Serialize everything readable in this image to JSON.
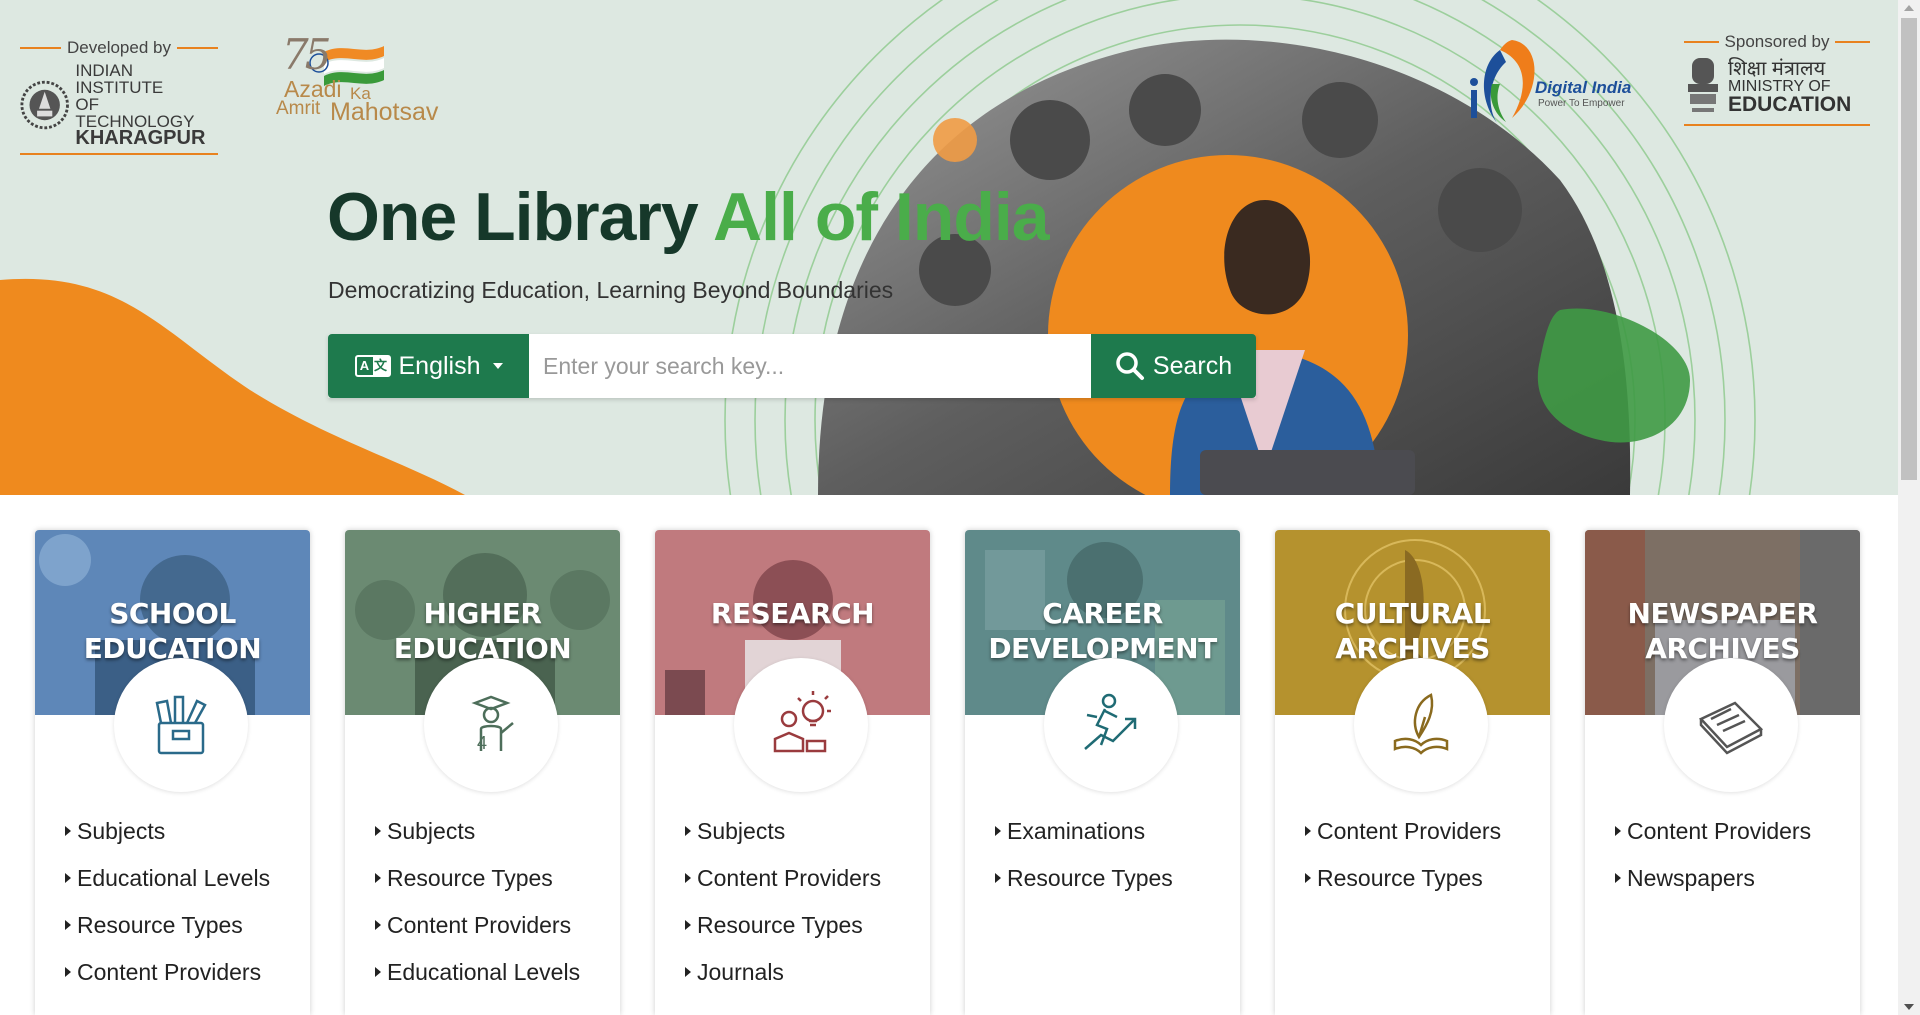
{
  "header": {
    "developed_by": "Developed by",
    "iit_line1": "INDIAN INSTITUTE",
    "iit_line2": "OF TECHNOLOGY",
    "iit_line3": "KHARAGPUR",
    "akam_75": "75",
    "akam_azadi": "Azadi",
    "akam_ka": "Ka",
    "akam_amrit": "Amrit",
    "akam_mahotsav": "Mahotsav",
    "digital_india": "Digital India",
    "digital_tagline": "Power To Empower",
    "sponsored_by": "Sponsored by",
    "moe_hindi": "शिक्षा मंत्रालय",
    "moe_line1": "MINISTRY OF",
    "moe_line2": "EDUCATION"
  },
  "hero": {
    "title_part1": "One Library",
    "title_part2": "All of India",
    "subtitle": "Democratizing Education, Learning Beyond Boundaries",
    "language_label": "English",
    "language_icon_text": [
      "A",
      "文"
    ],
    "search_placeholder": "Enter your search key...",
    "search_button": "Search"
  },
  "cards": [
    {
      "title": "SCHOOL EDUCATION",
      "icon": "school-supplies-icon",
      "links": [
        "Subjects",
        "Educational Levels",
        "Resource Types",
        "Content Providers"
      ]
    },
    {
      "title": "HIGHER EDUCATION",
      "icon": "graduate-icon",
      "links": [
        "Subjects",
        "Resource Types",
        "Content Providers",
        "Educational Levels"
      ]
    },
    {
      "title": "RESEARCH",
      "icon": "research-idea-icon",
      "links": [
        "Subjects",
        "Content Providers",
        "Resource Types",
        "Journals"
      ]
    },
    {
      "title": "CAREER DEVELOPMENT",
      "icon": "career-growth-icon",
      "links": [
        "Examinations",
        "Resource Types"
      ]
    },
    {
      "title": "CULTURAL ARCHIVES",
      "icon": "quill-book-icon",
      "links": [
        "Content Providers",
        "Resource Types"
      ]
    },
    {
      "title": "NEWSPAPER ARCHIVES",
      "icon": "newspaper-icon",
      "links": [
        "Content Providers",
        "Newspapers"
      ]
    }
  ],
  "colors": {
    "hero_bg": "#dde8e1",
    "brand_green": "#1e7a4d",
    "title_dark": "#16382a",
    "title_green": "#4aad4a",
    "accent_orange": "#ef8a1e"
  }
}
